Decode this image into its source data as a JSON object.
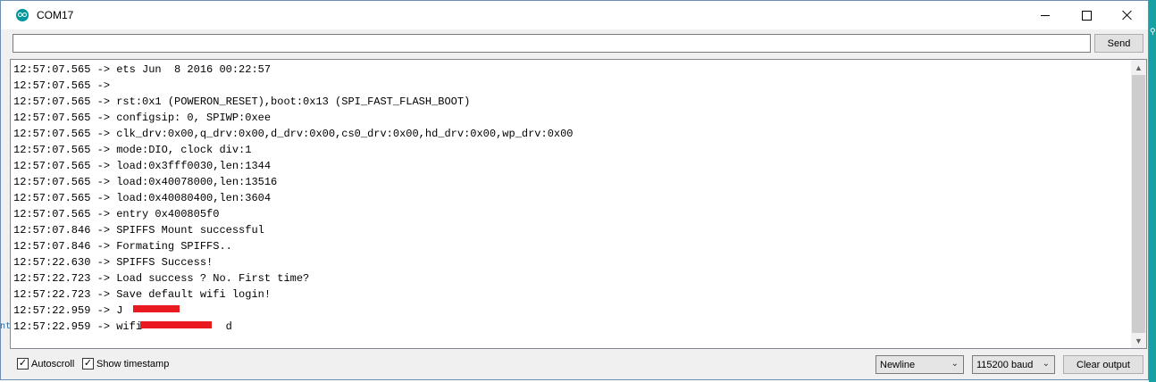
{
  "window": {
    "title": "COM17"
  },
  "input": {
    "value": "",
    "send_label": "Send"
  },
  "output": {
    "lines": [
      "12:57:07.565 -> ets Jun  8 2016 00:22:57",
      "12:57:07.565 -> ",
      "12:57:07.565 -> rst:0x1 (POWERON_RESET),boot:0x13 (SPI_FAST_FLASH_BOOT)",
      "12:57:07.565 -> configsip: 0, SPIWP:0xee",
      "12:57:07.565 -> clk_drv:0x00,q_drv:0x00,d_drv:0x00,cs0_drv:0x00,hd_drv:0x00,wp_drv:0x00",
      "12:57:07.565 -> mode:DIO, clock div:1",
      "12:57:07.565 -> load:0x3fff0030,len:1344",
      "12:57:07.565 -> load:0x40078000,len:13516",
      "12:57:07.565 -> load:0x40080400,len:3604",
      "12:57:07.565 -> entry 0x400805f0",
      "12:57:07.846 -> SPIFFS Mount successful",
      "12:57:07.846 -> Formating SPIFFS..",
      "12:57:22.630 -> SPIFFS Success!",
      "12:57:22.723 -> Load success ? No. First time?",
      "12:57:22.723 -> Save default wifi login!",
      "12:57:22.959 -> J",
      "12:57:22.959 -> wifi             d"
    ]
  },
  "footer": {
    "autoscroll_label": "Autoscroll",
    "autoscroll_checked": true,
    "timestamp_label": "Show timestamp",
    "timestamp_checked": true,
    "line_ending": "Newline",
    "baud": "115200 baud",
    "clear_label": "Clear output"
  },
  "background": {
    "left_fragment": "nt"
  },
  "colors": {
    "accent": "#00979c",
    "redaction": "#e8191f"
  },
  "icons": {
    "app": "arduino-icon",
    "minimize": "minimize-icon",
    "maximize": "maximize-icon",
    "close": "close-icon",
    "dropdown": "chevron-down-icon"
  }
}
